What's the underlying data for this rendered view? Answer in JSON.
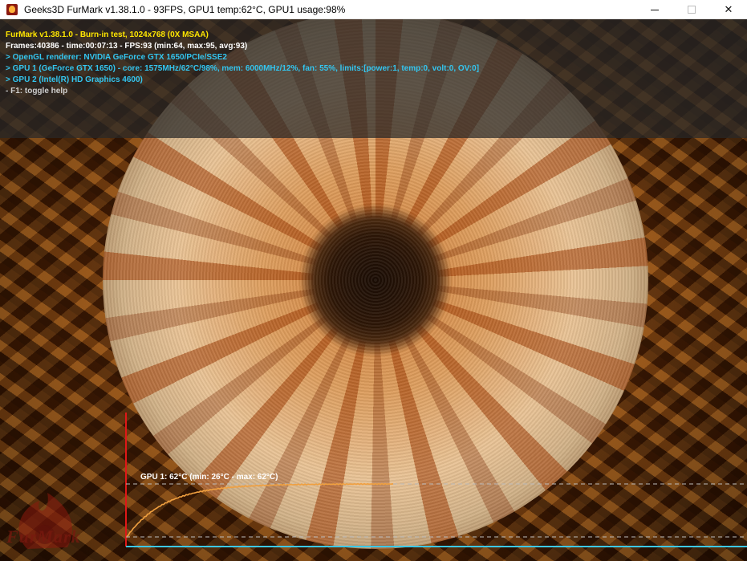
{
  "window": {
    "title": "Geeks3D FurMark v1.38.1.0 - 93FPS, GPU1 temp:62°C, GPU1 usage:98%",
    "minimize_glyph": "",
    "close_glyph": "✕"
  },
  "osd": {
    "line1": "FurMark v1.38.1.0 - Burn-in test, 1024x768 (0X MSAA)",
    "line2": "Frames:40386 - time:00:07:13 - FPS:93 (min:64, max:95, avg:93)",
    "line3": "> OpenGL renderer: NVIDIA GeForce GTX 1650/PCIe/SSE2",
    "line4": "> GPU 1 (GeForce GTX 1650) - core: 1575MHz/62°C/98%, mem: 6000MHz/12%, fan: 55%, limits:[power:1, temp:0, volt:0, OV:0]",
    "line5": "> GPU 2 (Intel(R) HD Graphics 4600)",
    "line6": "- F1: toggle help"
  },
  "graph": {
    "label": "GPU 1: 62°C (min: 26°C - max: 62°C)",
    "min_temp": 26,
    "max_temp": 62,
    "current_temp": 62,
    "colors": {
      "curve": "#f0a040",
      "axis_red": "#e01818",
      "axis_cyan": "#3cc8e6",
      "guide": "#bcbcbc"
    }
  },
  "logo": {
    "text": "FurMark"
  }
}
